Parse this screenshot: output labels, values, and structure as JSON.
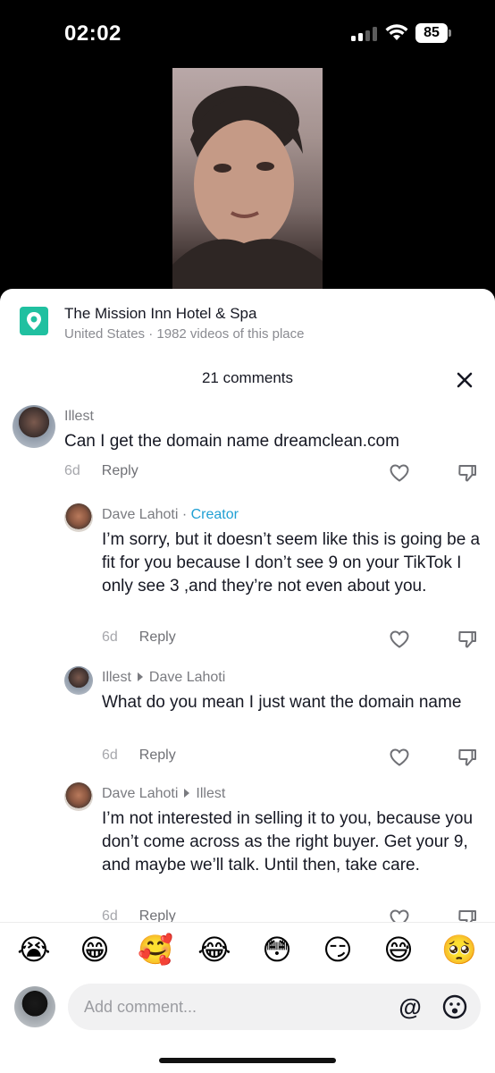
{
  "status_bar": {
    "time": "02:02",
    "battery": "85"
  },
  "place": {
    "name": "The Mission Inn Hotel & Spa",
    "meta": "United States · 1982 videos of this place",
    "icon": "location-pin-icon"
  },
  "comments_header": {
    "count_label": "21 comments"
  },
  "comments": [
    {
      "user": "Illest",
      "text": "Can I get the domain name dreamclean.com",
      "age": "6d",
      "reply_label": "Reply"
    },
    {
      "user": "Dave Lahoti",
      "badge_sep": " · ",
      "badge": "Creator",
      "text": "I’m sorry, but it doesn’t seem like this is going be a fit for you because I don’t see 9 on your TikTok I only see 3 ,and they’re not even about you.",
      "age": "6d",
      "reply_label": "Reply"
    },
    {
      "user": "Illest",
      "reply_to": "Dave Lahoti",
      "text": "What do you mean I just want the domain name",
      "age": "6d",
      "reply_label": "Reply"
    },
    {
      "user": "Dave Lahoti",
      "reply_to": "Illest",
      "text": "I’m not interested in selling it to you, because you don’t come across as the right buyer. Get your 9, and maybe we’ll talk. Until then, take care.",
      "age": "6d",
      "reply_label": "Reply"
    }
  ],
  "emoji_bar": [
    "😭",
    "😁",
    "🥰",
    "😂",
    "😳",
    "😏",
    "😅",
    "🥺"
  ],
  "input": {
    "placeholder": "Add comment...",
    "at_label": "@"
  },
  "colors": {
    "creator": "#20a0d4",
    "place_icon": "#20c0a0"
  }
}
